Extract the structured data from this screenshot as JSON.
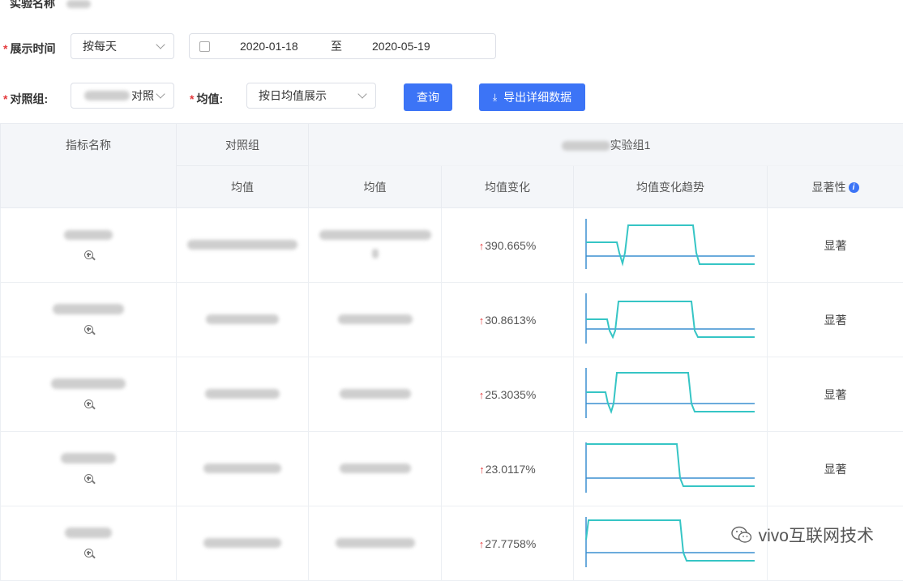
{
  "experiment": {
    "label": "实验名称"
  },
  "filters": {
    "display_time_label": "展示时间",
    "display_mode": "按每天",
    "date_start": "2020-01-18",
    "date_sep": "至",
    "date_end": "2020-05-19",
    "control_label": "对照组:",
    "control_value_suffix": "对照",
    "mean_label": "均值:",
    "mean_value": "按日均值展示",
    "query_button": "查询",
    "export_button": "导出详细数据"
  },
  "table": {
    "headers": {
      "metric_name": "指标名称",
      "control_group": "对照组",
      "experiment_group_suffix": "实验组1",
      "control_mean": "均值",
      "exp_mean": "均值",
      "mean_change": "均值变化",
      "mean_trend": "均值变化趋势",
      "significance": "显著性"
    },
    "rows": [
      {
        "change": "390.665%",
        "significance": "显著"
      },
      {
        "change": "30.8613%",
        "significance": "显著"
      },
      {
        "change": "25.3035%",
        "significance": "显著"
      },
      {
        "change": "23.0117%",
        "significance": "显著"
      },
      {
        "change": "27.7758%",
        "significance": ""
      }
    ]
  },
  "watermark": {
    "text": "vivo互联网技术"
  },
  "colors": {
    "accent": "#3c74f6",
    "trend_line": "#36c5c5",
    "baseline": "#3a8fd0",
    "up_arrow": "#e4393c"
  }
}
